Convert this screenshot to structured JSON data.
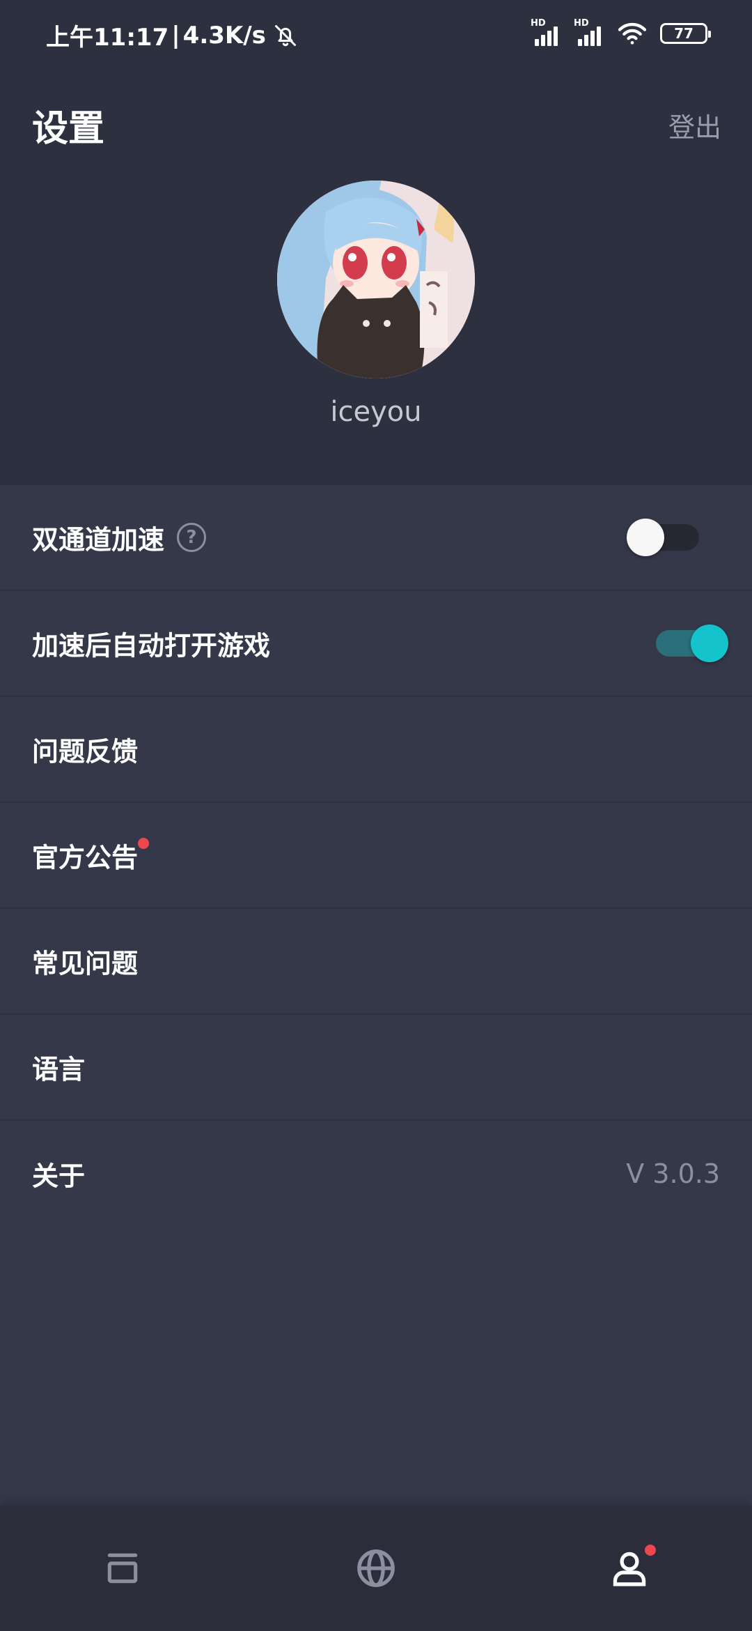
{
  "status_bar": {
    "time": "上午11:17",
    "separator": "|",
    "speed": "4.3K/s",
    "mute_icon": "bell-off-icon",
    "signal_1": {
      "label": "HD",
      "icon": "cellular-signal-icon"
    },
    "signal_2": {
      "label": "HD",
      "icon": "cellular-signal-icon"
    },
    "wifi_icon": "wifi-icon",
    "battery_level": "77"
  },
  "header": {
    "title": "设置",
    "logout_label": "登出"
  },
  "profile": {
    "avatar_icon": "anime-avatar-image",
    "username": "iceyou"
  },
  "settings": {
    "dual_channel": {
      "label": "双通道加速",
      "help_icon": "question-circle-icon",
      "help_glyph": "?",
      "enabled": false
    },
    "auto_open": {
      "label": "加速后自动打开游戏",
      "enabled": true
    },
    "feedback": {
      "label": "问题反馈"
    },
    "announcements": {
      "label": "官方公告",
      "has_notification": true
    },
    "faq": {
      "label": "常见问题"
    },
    "language": {
      "label": "语言"
    },
    "about": {
      "label": "关于",
      "version": "V 3.0.3"
    }
  },
  "bottom_nav": {
    "items": [
      {
        "icon": "library-icon",
        "active": false
      },
      {
        "icon": "globe-icon",
        "active": false
      },
      {
        "icon": "user-icon",
        "active": true,
        "has_notification": true
      }
    ]
  },
  "colors": {
    "background": "#353848",
    "header_background": "#2d303e",
    "accent": "#15c3cc",
    "notification_dot": "#f0474e",
    "muted_text": "#8c8fa0"
  }
}
